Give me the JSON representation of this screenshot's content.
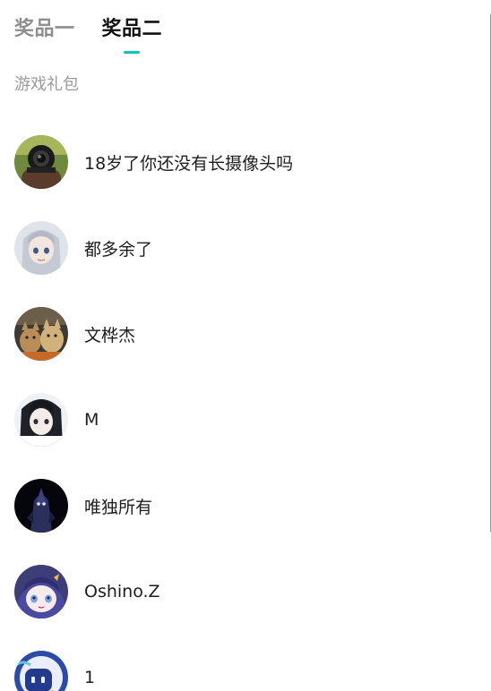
{
  "tabs": [
    {
      "label": "奖品一",
      "active": false
    },
    {
      "label": "奖品二",
      "active": true
    }
  ],
  "accent_color": "#10c3b8",
  "section_title": "游戏礼包",
  "winners": [
    {
      "name": "18岁了你还没有长摄像头吗",
      "avatar": "camera-avatar"
    },
    {
      "name": "都多余了",
      "avatar": "anime-white-hair-avatar"
    },
    {
      "name": "文桦杰",
      "avatar": "cats-avatar"
    },
    {
      "name": "M",
      "avatar": "anime-black-hair-avatar"
    },
    {
      "name": "唯独所有",
      "avatar": "dark-robot-avatar"
    },
    {
      "name": "Oshino.Z",
      "avatar": "anime-chibi-avatar"
    },
    {
      "name": "1",
      "avatar": "blue-robot-avatar"
    }
  ]
}
